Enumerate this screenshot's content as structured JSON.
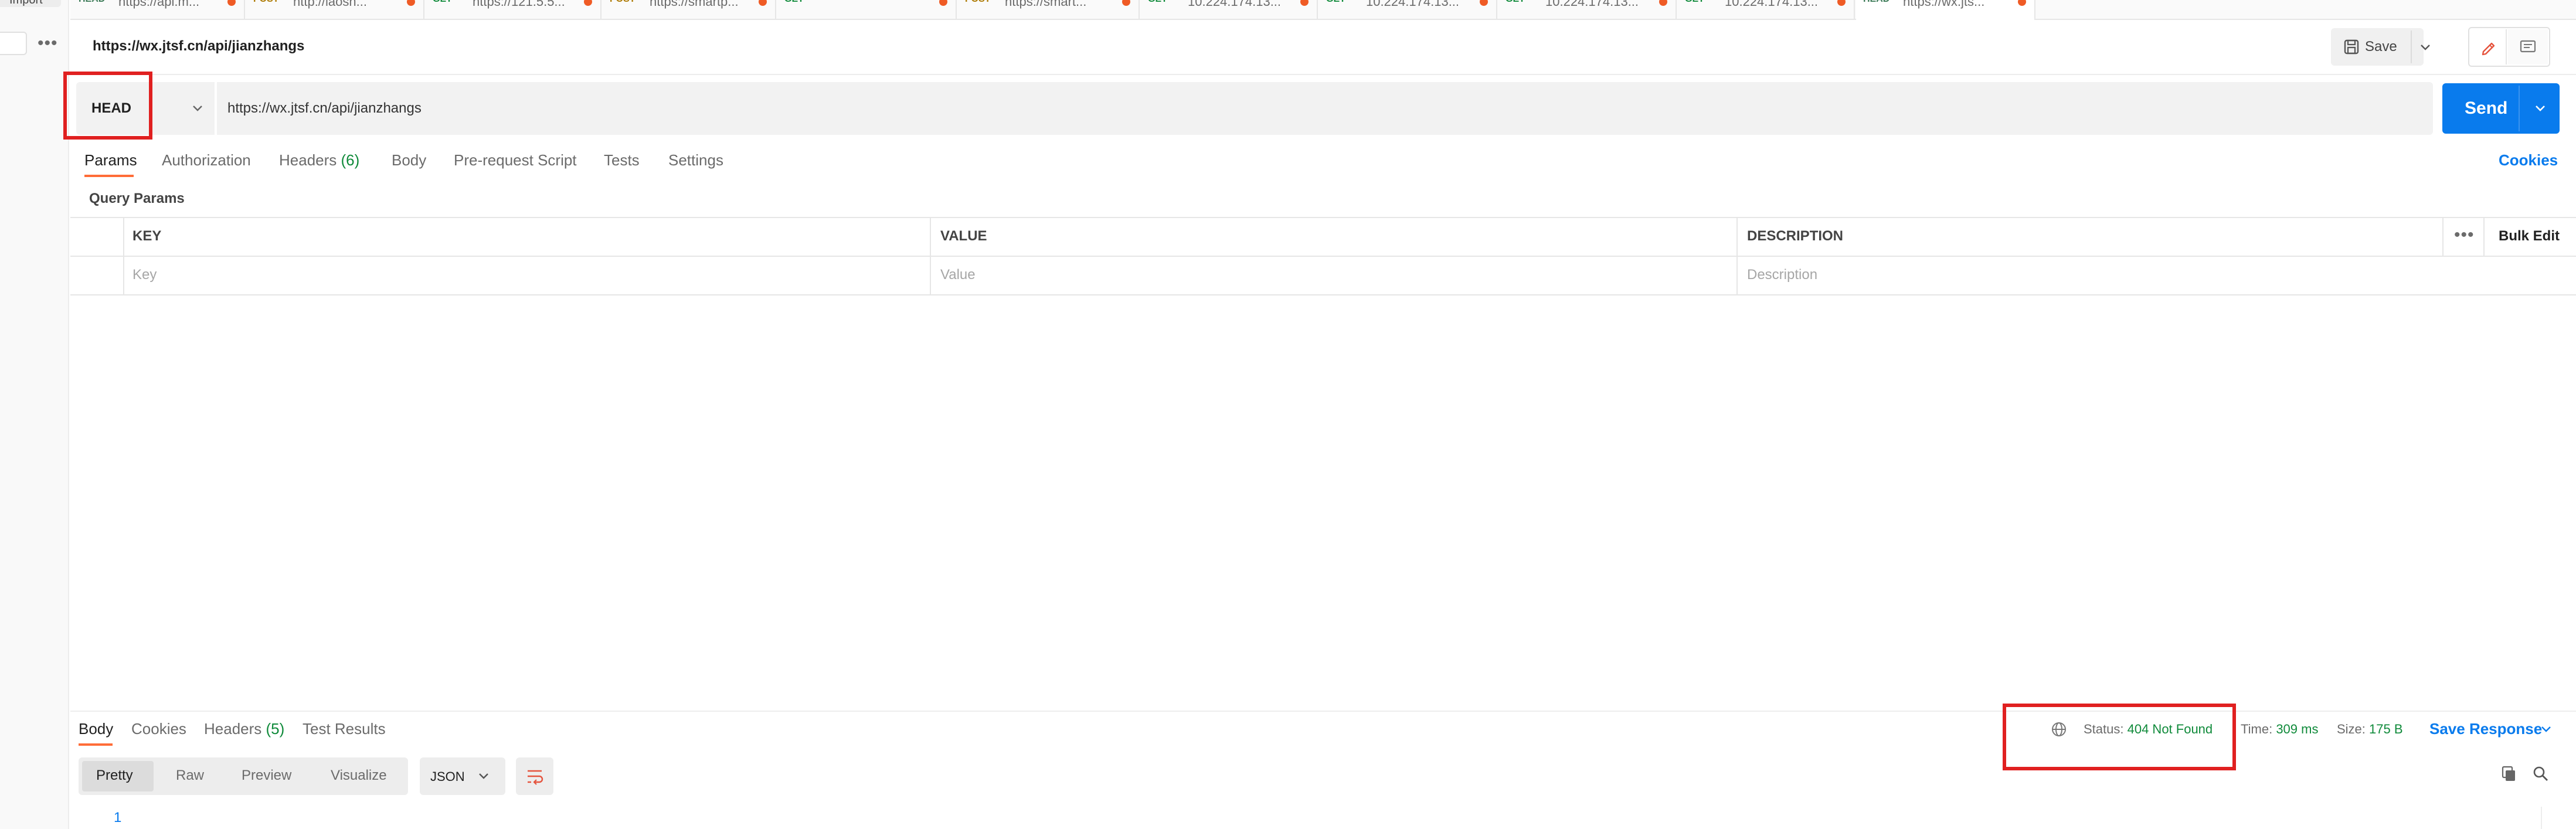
{
  "left": {
    "import_label": "Import",
    "more_glyph": "•••"
  },
  "tabs": [
    {
      "method": "HEAD",
      "url": "https://api.m...",
      "method_color": "#3b7a57"
    },
    {
      "method": "POST",
      "url": "http://laosh...",
      "method_color": "#ad7a03"
    },
    {
      "method": "GET",
      "url": "https://121.5.5...",
      "method_color": "#0f8a3a"
    },
    {
      "method": "POST",
      "url": "https://smartp...",
      "method_color": "#ad7a03"
    },
    {
      "method": "GET",
      "url": "",
      "method_color": "#0f8a3a"
    },
    {
      "method": "POST",
      "url": "https://smart...",
      "method_color": "#ad7a03"
    },
    {
      "method": "GET",
      "url": "10.224.174.13...",
      "method_color": "#0f8a3a"
    },
    {
      "method": "GET",
      "url": "10.224.174.13...",
      "method_color": "#0f8a3a"
    },
    {
      "method": "GET",
      "url": "10.224.174.13...",
      "method_color": "#0f8a3a"
    },
    {
      "method": "GET",
      "url": "10.224.174.13...",
      "method_color": "#0f8a3a"
    },
    {
      "method": "HEAD",
      "url": "https://wx.jts...",
      "method_color": "#3b7a57"
    }
  ],
  "request": {
    "title": "https://wx.jtsf.cn/api/jianzhangs",
    "save_label": "Save",
    "method": "HEAD",
    "url": "https://wx.jtsf.cn/api/jianzhangs",
    "send_label": "Send"
  },
  "request_tabs": {
    "params": "Params",
    "authorization": "Authorization",
    "headers": "Headers",
    "headers_count": "(6)",
    "body": "Body",
    "pre_request": "Pre-request Script",
    "tests": "Tests",
    "settings": "Settings",
    "cookies": "Cookies"
  },
  "query_params": {
    "label": "Query Params",
    "columns": {
      "key": "KEY",
      "value": "VALUE",
      "description": "DESCRIPTION"
    },
    "placeholders": {
      "key": "Key",
      "value": "Value",
      "description": "Description"
    },
    "more_glyph": "•••",
    "bulk_edit": "Bulk Edit"
  },
  "response": {
    "tabs": {
      "body": "Body",
      "cookies": "Cookies",
      "headers": "Headers",
      "headers_count": "(5)",
      "test_results": "Test Results"
    },
    "status_key": "Status:",
    "status_value": "404 Not Found",
    "time_key": "Time:",
    "time_value": "309 ms",
    "size_key": "Size:",
    "size_value": "175 B",
    "save_response": "Save Response",
    "views": {
      "pretty": "Pretty",
      "raw": "Raw",
      "preview": "Preview",
      "visualize": "Visualize"
    },
    "format": "JSON",
    "line_number": "1"
  },
  "colors": {
    "accent": "#ff6c37",
    "primary": "#097bed",
    "success": "#0f8a3a",
    "highlight": "#e02020"
  },
  "icons": {
    "save": "save-icon",
    "edit": "pencil-icon",
    "documentation": "comment-icon",
    "globe": "globe-icon",
    "wrap": "wrap-lines-icon",
    "copy": "copy-icon",
    "search": "search-icon"
  }
}
